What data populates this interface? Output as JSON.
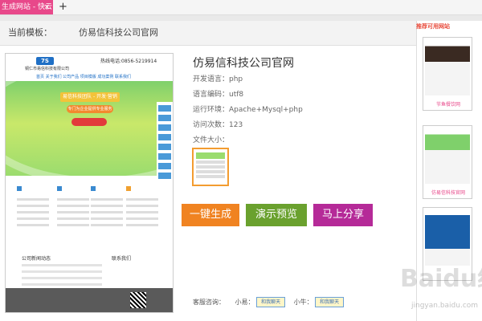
{
  "browser": {
    "tab_label": "生成网站 - 快云",
    "tab_close": "×",
    "new_tab": "+"
  },
  "breadcrumb": {
    "label": "当前模板：",
    "value": "仿易信科技公司官网"
  },
  "preview": {
    "logo_text": "7S",
    "company": "铜仁市易信科技有限公司",
    "hotline": "热线电话:0856-5219914",
    "nav": "首页  关于我们  公司产品  项目模版  成功案例  联系我们",
    "banner_line1": "易信科技团队 - 开发·营销",
    "banner_line2": "专门为企业提供专业服务",
    "news_title": "公司新闻动态",
    "contact_title": "联系我们"
  },
  "template": {
    "title": "仿易信科技公司官网",
    "lang": "开发语言：php",
    "encoding": "语言编码：utf8",
    "env": "运行环境：Apache+Mysql+php",
    "visits": "访问次数：123",
    "size": "文件大小："
  },
  "actions": {
    "generate": "一键生成",
    "preview": "演示预览",
    "share": "马上分享"
  },
  "contact_bar": {
    "label": "客服咨询：",
    "xiaoyi": "小易：",
    "xiaoniu": "小牛：",
    "qq_label": "和我聊天"
  },
  "recommend": {
    "title": "推荐可用网站",
    "items": [
      {
        "label": "节鱼餐饮网"
      },
      {
        "label": "仿易信科技官网"
      },
      {
        "label": ""
      }
    ]
  },
  "watermark": {
    "text": "Baidu经验",
    "url": "jingyan.baidu.com"
  },
  "colors": {
    "accent_pink": "#e8488a",
    "generate_btn": "#f08321",
    "preview_btn": "#6aa12e",
    "share_btn": "#b52a98"
  }
}
